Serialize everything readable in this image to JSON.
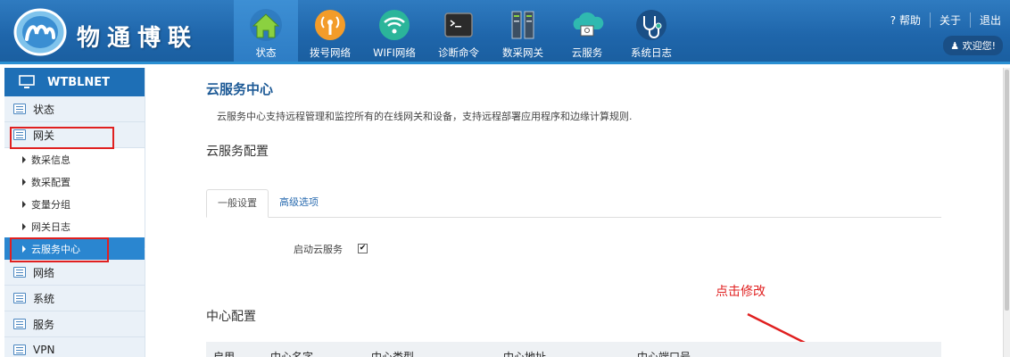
{
  "brand": "物通博联",
  "nav": [
    {
      "label": "状态",
      "icon": "home-icon"
    },
    {
      "label": "拨号网络",
      "icon": "dialup-icon"
    },
    {
      "label": "WIFI网络",
      "icon": "wifi-icon"
    },
    {
      "label": "诊断命令",
      "icon": "terminal-icon"
    },
    {
      "label": "数采网关",
      "icon": "server-icon"
    },
    {
      "label": "云服务",
      "icon": "cloud-icon"
    },
    {
      "label": "系统日志",
      "icon": "stethoscope-icon"
    }
  ],
  "topright": {
    "help": "帮助",
    "about": "关于",
    "logout": "退出",
    "welcome": "欢迎您!"
  },
  "sidebar": {
    "title": "WTBLNET",
    "menus": [
      "状态",
      "网关",
      "网络",
      "系统",
      "服务",
      "VPN"
    ],
    "sub_items": [
      "数采信息",
      "数采配置",
      "变量分组",
      "网关日志",
      "云服务中心"
    ]
  },
  "main": {
    "title": "云服务中心",
    "description": "云服务中心支持远程管理和监控所有的在线网关和设备，支持远程部署应用程序和边缘计算规则.",
    "section1": "云服务配置",
    "tabs": [
      "一般设置",
      "高级选项"
    ],
    "enable_label": "启动云服务",
    "enable_checked": "✔",
    "section2": "中心配置",
    "annotation": "点击修改",
    "table_headers": [
      "启用",
      "中心名字",
      "中心类型",
      "中心地址",
      "中心端口号"
    ]
  },
  "colors": {
    "header": "#1f66ab",
    "accent": "#2a86d0",
    "annotation": "#e02020"
  }
}
